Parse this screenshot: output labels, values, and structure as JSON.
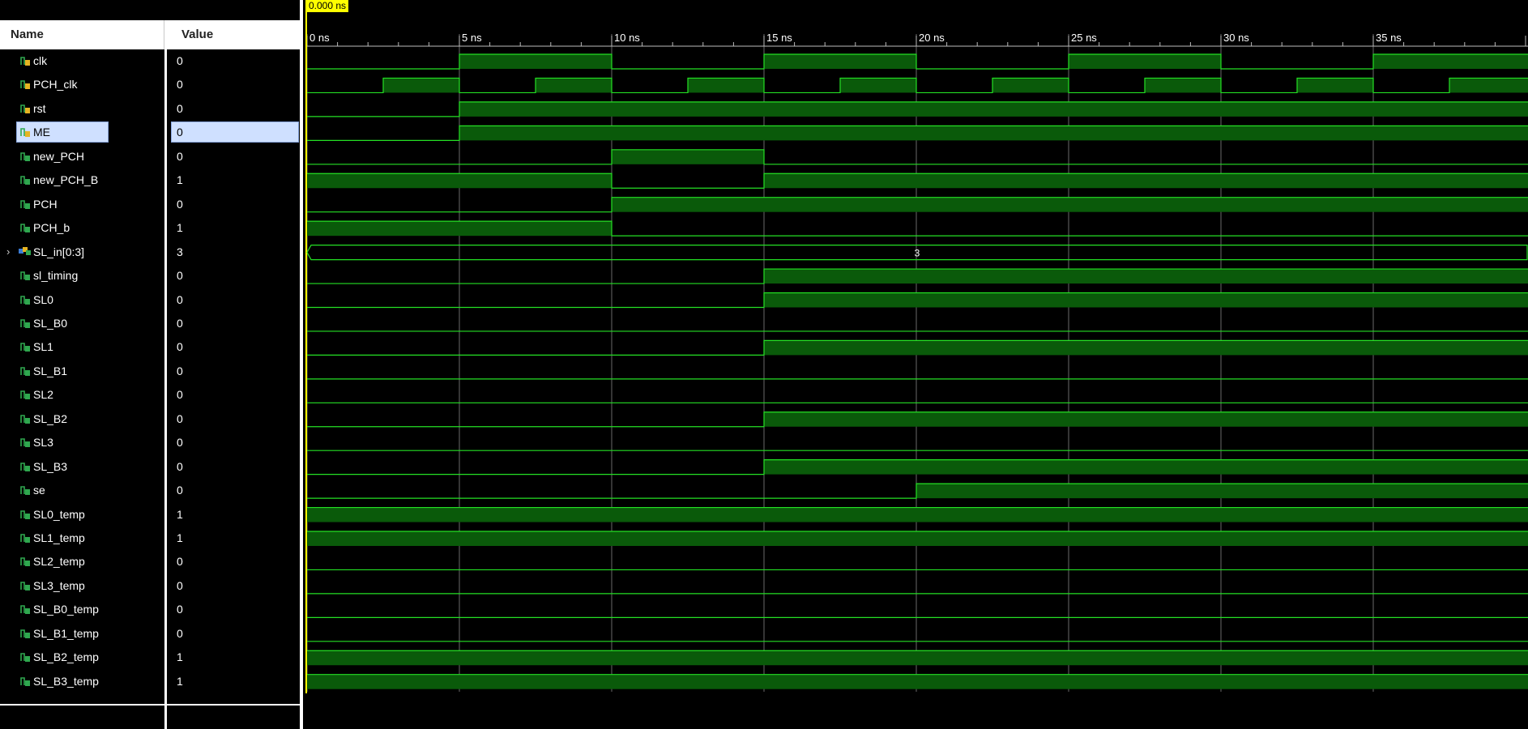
{
  "header": {
    "name_label": "Name",
    "value_label": "Value"
  },
  "cursor": {
    "time_label": "0.000 ns"
  },
  "timeline": {
    "tick_labels": [
      "0 ns",
      "5 ns",
      "10 ns",
      "15 ns",
      "20 ns",
      "25 ns",
      "30 ns",
      "35 ns"
    ]
  },
  "colors": {
    "wave_line": "#24e024",
    "wave_fill": "#0a5a0a",
    "grid": "#505050",
    "cursor": "#ffff00"
  },
  "signals": [
    {
      "name": "clk",
      "value": "0",
      "icon": "clock-signal-icon"
    },
    {
      "name": "PCH_clk",
      "value": "0",
      "icon": "clock-signal-icon"
    },
    {
      "name": "rst",
      "value": "0",
      "icon": "clock-signal-icon"
    },
    {
      "name": "ME",
      "value": "0",
      "icon": "clock-signal-icon",
      "selected": true
    },
    {
      "name": "new_PCH",
      "value": "0",
      "icon": "logic-signal-icon"
    },
    {
      "name": "new_PCH_B",
      "value": "1",
      "icon": "logic-signal-icon"
    },
    {
      "name": "PCH",
      "value": "0",
      "icon": "logic-signal-icon"
    },
    {
      "name": "PCH_b",
      "value": "1",
      "icon": "logic-signal-icon"
    },
    {
      "name": "SL_in[0:3]",
      "value": "3",
      "icon": "bus-signal-icon",
      "bus": true,
      "bus_value": "3"
    },
    {
      "name": "sl_timing",
      "value": "0",
      "icon": "logic-signal-icon"
    },
    {
      "name": "SL0",
      "value": "0",
      "icon": "logic-signal-icon"
    },
    {
      "name": "SL_B0",
      "value": "0",
      "icon": "logic-signal-icon"
    },
    {
      "name": "SL1",
      "value": "0",
      "icon": "logic-signal-icon"
    },
    {
      "name": "SL_B1",
      "value": "0",
      "icon": "logic-signal-icon"
    },
    {
      "name": "SL2",
      "value": "0",
      "icon": "logic-signal-icon"
    },
    {
      "name": "SL_B2",
      "value": "0",
      "icon": "logic-signal-icon"
    },
    {
      "name": "SL3",
      "value": "0",
      "icon": "logic-signal-icon"
    },
    {
      "name": "SL_B3",
      "value": "0",
      "icon": "logic-signal-icon"
    },
    {
      "name": "se",
      "value": "0",
      "icon": "logic-signal-icon"
    },
    {
      "name": "SL0_temp",
      "value": "1",
      "icon": "logic-signal-icon"
    },
    {
      "name": "SL1_temp",
      "value": "1",
      "icon": "logic-signal-icon"
    },
    {
      "name": "SL2_temp",
      "value": "0",
      "icon": "logic-signal-icon"
    },
    {
      "name": "SL3_temp",
      "value": "0",
      "icon": "logic-signal-icon"
    },
    {
      "name": "SL_B0_temp",
      "value": "0",
      "icon": "logic-signal-icon"
    },
    {
      "name": "SL_B1_temp",
      "value": "0",
      "icon": "logic-signal-icon"
    },
    {
      "name": "SL_B2_temp",
      "value": "1",
      "icon": "logic-signal-icon"
    },
    {
      "name": "SL_B3_temp",
      "value": "1",
      "icon": "logic-signal-icon"
    }
  ],
  "waveforms": {
    "time_unit": "ns",
    "traces": [
      {
        "signal": "clk",
        "initial": 0,
        "transitions": [
          5,
          10,
          15,
          20,
          25,
          30,
          35
        ]
      },
      {
        "signal": "PCH_clk",
        "initial": 0,
        "transitions": [
          2.5,
          5,
          7.5,
          10,
          12.5,
          15,
          17.5,
          20,
          22.5,
          25,
          27.5,
          30,
          32.5,
          35,
          37.5
        ]
      },
      {
        "signal": "rst",
        "initial": 0,
        "transitions": [
          5
        ]
      },
      {
        "signal": "ME",
        "initial": 0,
        "transitions": [
          5
        ]
      },
      {
        "signal": "new_PCH",
        "initial": 0,
        "transitions": [
          10,
          15
        ]
      },
      {
        "signal": "new_PCH_B",
        "initial": 1,
        "transitions": [
          10,
          15
        ]
      },
      {
        "signal": "PCH",
        "initial": 0,
        "transitions": [
          10
        ]
      },
      {
        "signal": "PCH_b",
        "initial": 1,
        "transitions": [
          10
        ]
      },
      {
        "signal": "SL_in[0:3]",
        "bus": true,
        "label": "3"
      },
      {
        "signal": "sl_timing",
        "initial": 0,
        "transitions": [
          15
        ]
      },
      {
        "signal": "SL0",
        "initial": 0,
        "transitions": [
          15
        ]
      },
      {
        "signal": "SL_B0",
        "initial": 0,
        "transitions": []
      },
      {
        "signal": "SL1",
        "initial": 0,
        "transitions": [
          15
        ]
      },
      {
        "signal": "SL_B1",
        "initial": 0,
        "transitions": []
      },
      {
        "signal": "SL2",
        "initial": 0,
        "transitions": []
      },
      {
        "signal": "SL_B2",
        "initial": 0,
        "transitions": [
          15
        ]
      },
      {
        "signal": "SL3",
        "initial": 0,
        "transitions": []
      },
      {
        "signal": "SL_B3",
        "initial": 0,
        "transitions": [
          15
        ]
      },
      {
        "signal": "se",
        "initial": 0,
        "transitions": [
          20
        ]
      },
      {
        "signal": "SL0_temp",
        "initial": 1,
        "transitions": []
      },
      {
        "signal": "SL1_temp",
        "initial": 1,
        "transitions": []
      },
      {
        "signal": "SL2_temp",
        "initial": 0,
        "transitions": []
      },
      {
        "signal": "SL3_temp",
        "initial": 0,
        "transitions": []
      },
      {
        "signal": "SL_B0_temp",
        "initial": 0,
        "transitions": []
      },
      {
        "signal": "SL_B1_temp",
        "initial": 0,
        "transitions": []
      },
      {
        "signal": "SL_B2_temp",
        "initial": 1,
        "transitions": []
      },
      {
        "signal": "SL_B3_temp",
        "initial": 1,
        "transitions": []
      }
    ]
  }
}
